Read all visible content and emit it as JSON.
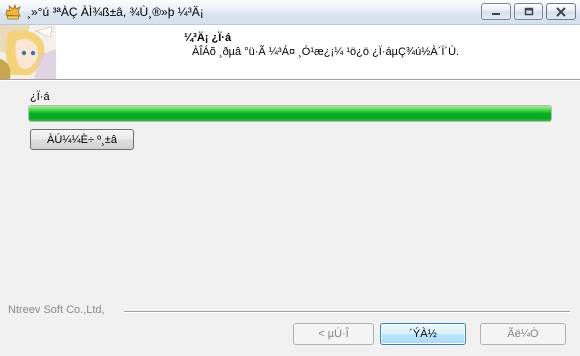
{
  "window": {
    "title": "¸»°ú ³ªÀÇ ÀÌ¾ß±â, ¾Ù¸®»þ ¼³Ä¡",
    "icon": "installer-app-icon"
  },
  "title_buttons": {
    "minimize": "minimize-icon",
    "maximize": "maximize-icon",
    "close": "close-icon"
  },
  "header": {
    "title": "¼³Ä¡ ¿Ï·á",
    "subtitle": "ÀÎÁõ ¸ðµâ °ü·Ã ¼³Á¤ ¸Ó¹æ¿¡¼­ ¹ö¿ö ¿Ï·áµÇ¾ú½À´Ï´Ù."
  },
  "main": {
    "status_label": "¿Ï·á",
    "progress_percent": 100,
    "details_button": "ÀÚ¼¼È÷ º¸±â"
  },
  "footer": {
    "brand": "Ntreev Soft Co.,Ltd,",
    "back_button": "< µÚ·Î",
    "next_button": "´ÝÀ½",
    "cancel_button": "Ãë¼Ò"
  },
  "colors": {
    "progress_fill": "#06b025",
    "window_bg": "#f0f0f0",
    "header_bg": "#ffffff"
  }
}
